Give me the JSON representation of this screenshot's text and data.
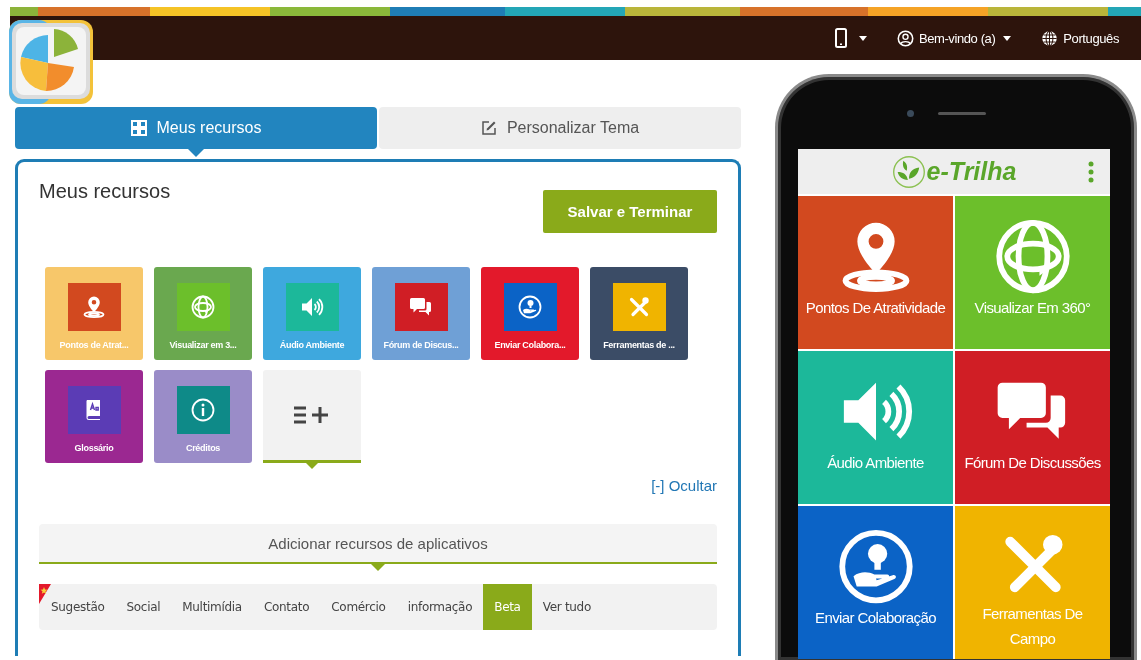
{
  "header": {
    "user_menu": "Bem-vindo (a)",
    "language": "Português"
  },
  "main_tabs": [
    {
      "label": "Meus recursos",
      "kind": "grid",
      "selected": true
    },
    {
      "label": "Personalizar Tema",
      "kind": "edit",
      "selected": false
    }
  ],
  "panel": {
    "title": "Meus recursos",
    "save_button": "Salvar e Terminar",
    "tiles": [
      {
        "kind": "pin",
        "label": "Pontos de Atrat...",
        "color": "#f7c76a"
      },
      {
        "kind": "globe",
        "label": "Visualizar em 3...",
        "color": "#6aa84f"
      },
      {
        "kind": "speaker",
        "label": "Áudio Ambiente",
        "color": "#3ea8de"
      },
      {
        "kind": "chat",
        "label": "Fórum de Discus...",
        "color": "#6fa0d6"
      },
      {
        "kind": "idea",
        "label": "Enviar Colabora...",
        "color": "#e3192b"
      },
      {
        "kind": "tools",
        "label": "Ferramentas de ...",
        "color": "#3b4c66"
      },
      {
        "kind": "book",
        "label": "Glossário",
        "color": "#9b2891"
      },
      {
        "kind": "info",
        "label": "Créditos",
        "color": "#9a8cc8"
      },
      {
        "kind": "add"
      }
    ],
    "hide_link": "[-] Ocultar",
    "add_section": {
      "title": "Adicionar recursos de aplicativos"
    },
    "categories": [
      {
        "label": "Sugestão",
        "selected": false,
        "starred": true
      },
      {
        "label": "Social",
        "selected": false,
        "starred": false
      },
      {
        "label": "Multimídia",
        "selected": false,
        "starred": false
      },
      {
        "label": "Contato",
        "selected": false,
        "starred": false
      },
      {
        "label": "Comércio",
        "selected": false,
        "starred": false
      },
      {
        "label": "informação",
        "selected": false,
        "starred": false
      },
      {
        "label": "Beta",
        "selected": true,
        "starred": false
      },
      {
        "label": "Ver tudo",
        "selected": false,
        "starred": false
      }
    ]
  },
  "phone": {
    "app_title": "e-Trilha",
    "tiles": [
      {
        "kind": "pin",
        "label": "Pontos De Atratividade",
        "color": "#d2491f"
      },
      {
        "kind": "globe",
        "label": "Visualizar Em 360°",
        "color": "#6cbf2b"
      },
      {
        "kind": "speaker",
        "label": "Áudio Ambiente",
        "color": "#1cb89a"
      },
      {
        "kind": "chat",
        "label": "Fórum De Discussões",
        "color": "#d01e25"
      },
      {
        "kind": "idea",
        "label": "Enviar Colaboração",
        "color": "#0b63c6"
      },
      {
        "kind": "tools",
        "label": "Ferramentas De Campo",
        "color": "#f0b400"
      }
    ]
  }
}
